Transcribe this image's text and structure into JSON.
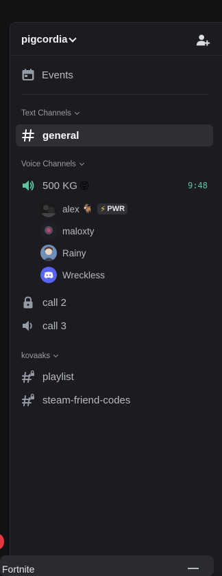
{
  "server": {
    "name": "pigcordia"
  },
  "events": {
    "label": "Events"
  },
  "categories": {
    "text": "Text Channels",
    "voice": "Voice Channels",
    "kovaaks": "kovaaks"
  },
  "channels": {
    "general": "general",
    "voice1": {
      "name": "500 KG",
      "emoji": "😝",
      "timer": "9:48"
    },
    "call2": "call 2",
    "call3": "call 3",
    "playlist": "playlist",
    "steam": "steam-friend-codes"
  },
  "voice_users": [
    {
      "name": "alex",
      "emoji": "🐐",
      "badge": "PWR"
    },
    {
      "name": "maloxty"
    },
    {
      "name": "Rainy"
    },
    {
      "name": "Wreckless"
    }
  ],
  "bottom": {
    "label": "Fortnite"
  },
  "colors": {
    "accent_green": "#57c7a1",
    "badge_bolt": "#f0c33c",
    "notification_red": "#e0393e"
  },
  "icons": {
    "invite": "add-user-icon",
    "events": "calendar-icon",
    "text_channel": "hash-icon",
    "voice_channel": "speaker-icon",
    "locked_voice": "lock-icon",
    "rules_channel": "hash-lock-icon"
  }
}
